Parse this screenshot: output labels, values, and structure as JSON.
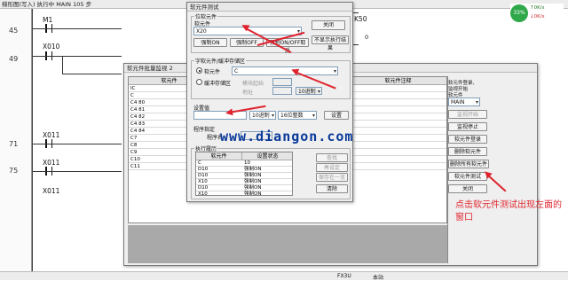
{
  "ladder": {
    "title": "梯形图(写入) 执行中  MAIN  105 步",
    "steps": [
      "45",
      "49",
      "71",
      "75"
    ],
    "contacts": [
      "M1",
      "X010",
      "X011",
      "X011",
      "X011"
    ],
    "right_label": "K50",
    "right_value": "0"
  },
  "status_gauge": {
    "value": "33%",
    "percent": 33,
    "rates": [
      "0K/s",
      "0K/s"
    ]
  },
  "monitor_window": {
    "title": "软元件批量监视 2",
    "col_device": "软元件",
    "col_comment": "软元件注释",
    "rows": [
      "IC",
      "C",
      "C4 80",
      "C4 81",
      "C4 82",
      "C4 83",
      "C4 84",
      "C7",
      "C8",
      "C9",
      "C10",
      "C11"
    ],
    "right_labels": [
      "软元件登录、",
      "监视开始",
      "软元件",
      "登录"
    ],
    "select_value": "MAIN",
    "buttons": [
      "监视开始",
      "监视停止",
      "软元件登录",
      "删除软元件",
      "删除所有软元件",
      "软元件测试",
      "关闭"
    ]
  },
  "test_dialog": {
    "title": "软元件测试",
    "bit_group_label": "位软元件",
    "bit_device_label": "软元件",
    "bit_device_value": "X20",
    "close_label": "关闭",
    "bit_buttons": [
      "强制ON",
      "强制OFF",
      "强制ON/OFF取反"
    ],
    "hide_result_label": "不显示执行结果",
    "word_group_label": "字软元件/缓冲存储区",
    "radio_device": "软元件",
    "radio_device_value": "C",
    "radio_buffer": "缓冲存储区",
    "module_start_label": "模块起始",
    "address_label": "地址",
    "radix_value": "10进制",
    "setting_value_label": "设置值",
    "value_radix": "10进制",
    "value_type": "16位整数",
    "set_button": "设置",
    "program_label": "程序指定",
    "program_name_label": "程序名",
    "history_label": "执行履历",
    "history_cols": [
      "软元件",
      "设置状态"
    ],
    "history_rows": [
      [
        "C",
        "10"
      ],
      [
        "D10",
        "强制ON"
      ],
      [
        "D10",
        "强制ON"
      ],
      [
        "X10",
        "强制ON"
      ],
      [
        "D10",
        "强制ON"
      ],
      [
        "X10",
        "强制ON"
      ]
    ],
    "history_buttons": [
      "查找",
      "再设定",
      "保存在一览",
      "清除"
    ]
  },
  "watermark": "www.diangon.com",
  "annotation": "点击软元件测试出现左面的窗口",
  "statusbar": [
    "FX3U",
    "本站"
  ]
}
